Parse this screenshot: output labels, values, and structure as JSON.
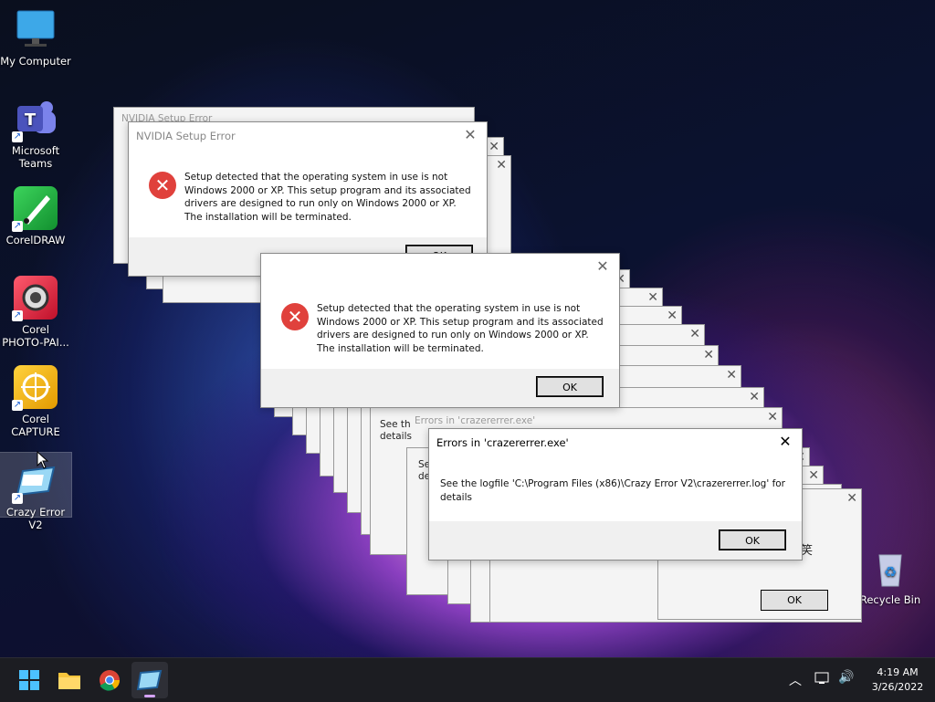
{
  "desktop": {
    "icons": [
      {
        "label": "My Computer"
      },
      {
        "label": "Microsoft Teams"
      },
      {
        "label": "CorelDRAW"
      },
      {
        "label": "Corel PHOTO-PAI..."
      },
      {
        "label": "Corel CAPTURE"
      },
      {
        "label": "Crazy Error V2"
      },
      {
        "label": "Recycle Bin"
      }
    ]
  },
  "dialog_nvidia": {
    "title": "NVIDIA Setup Error",
    "message_lines": [
      "Setup detected that the operating system in use is not",
      "Windows 2000 or XP. This setup program and its associated",
      "drivers are designed to run only on Windows 2000 or XP.",
      "The installation will be terminated."
    ],
    "ok": "OK",
    "ghost_title": "NVIDIA Setup Error"
  },
  "dialog_nvidia_2": {
    "message_lines": [
      "Setup detected that the operating system in use is not",
      "Windows 2000 or XP. This setup program and its associated",
      "drivers are designed to run only on Windows 2000 or XP.",
      "The installation will be terminated."
    ],
    "ok": "OK"
  },
  "dialog_crazy": {
    "title": "Errors in 'crazererrer.exe'",
    "message": "See the logfile 'C:\\Program Files (x86)\\Crazy Error V2\\crazererrer.log' for",
    "message_2": "details",
    "ok": "OK"
  },
  "ghost_text": {
    "see_th": "See th",
    "details": "details",
    "se": "Se",
    "de": "de",
    "errors_in": "Errors in 'crazererrer.exe'",
    "char": "笑"
  },
  "ok_label": "OK",
  "taskbar": {
    "time": "4:19 AM",
    "date": "3/26/2022"
  }
}
